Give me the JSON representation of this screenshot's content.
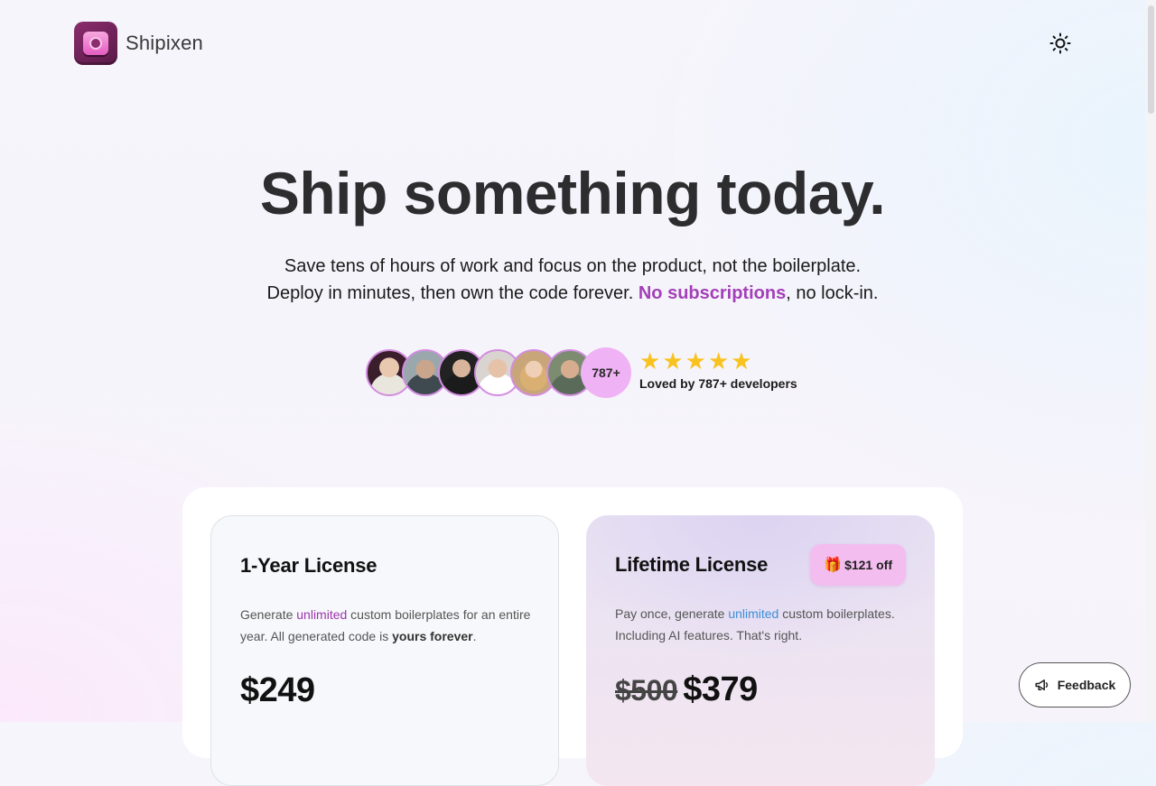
{
  "brand": {
    "name": "Shipixen"
  },
  "hero": {
    "headline": "Ship something today.",
    "sub_line1": "Save tens of hours of work and focus on the product, not the boilerplate.",
    "sub_line2_prefix": "Deploy in minutes, then own the code forever. ",
    "sub_line2_accent": "No subscriptions",
    "sub_line2_suffix": ", no lock-in."
  },
  "social_proof": {
    "count_badge": "787+",
    "stars": 5,
    "text": "Loved by 787+ developers"
  },
  "pricing": [
    {
      "title": "1-Year License",
      "desc_pre": "Generate ",
      "desc_highlight": "unlimited",
      "desc_mid": " custom boilerplates for an entire year. All generated code is ",
      "desc_strong": "yours forever",
      "desc_post": ".",
      "price": "$249"
    },
    {
      "title": "Lifetime License",
      "badge": "$121 off",
      "desc_pre": "Pay once, generate ",
      "desc_highlight": "unlimited",
      "desc_post": " custom boilerplates. Including AI features. That's right.",
      "price_old": "$500",
      "price": "$379"
    }
  ],
  "feedback": {
    "label": "Feedback"
  },
  "colors": {
    "accent": "#a33fb8",
    "star": "#f8c21f",
    "badge_bg": "#efb2f4"
  }
}
